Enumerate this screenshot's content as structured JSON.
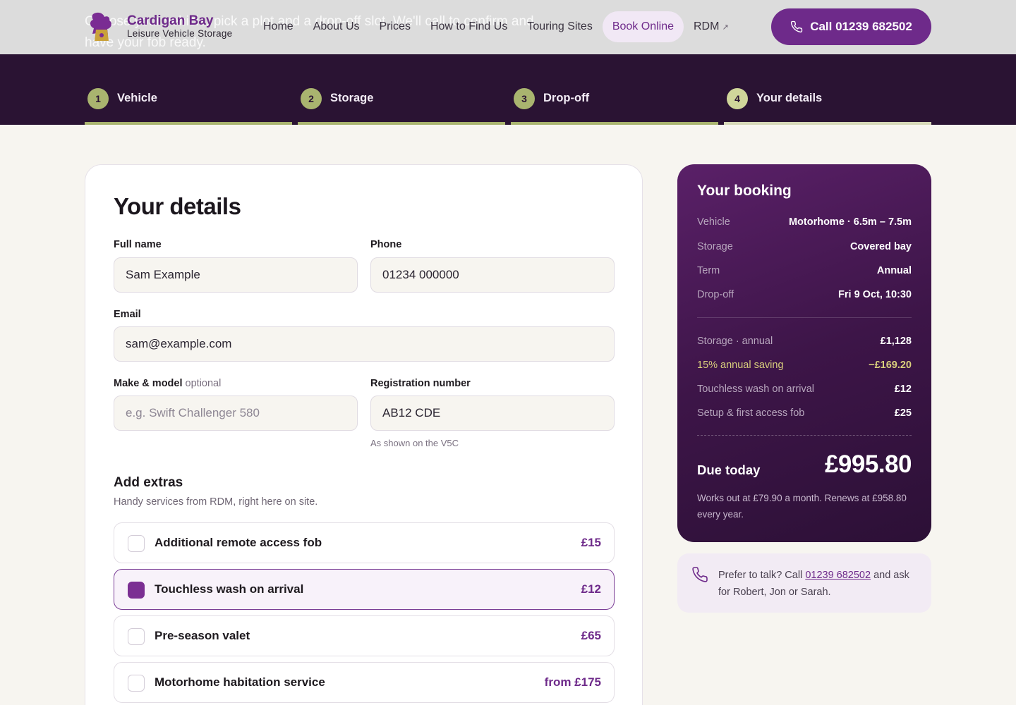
{
  "header": {
    "background_text": "Choose your vehicle, pick a plot and a drop-off slot. We'll call to confirm and have your fob ready.",
    "logo_title": "Cardigan Bay",
    "logo_subtitle": "Leisure Vehicle Storage",
    "nav": [
      {
        "label": "Home"
      },
      {
        "label": "About Us"
      },
      {
        "label": "Prices"
      },
      {
        "label": "How to Find Us"
      },
      {
        "label": "Touring Sites"
      },
      {
        "label": "Book Online",
        "active": true
      },
      {
        "label": "RDM",
        "external": true
      }
    ],
    "call_label": "Call 01239 682502",
    "brand_color": "#6e2a8a"
  },
  "steps": [
    {
      "number": "1",
      "label": "Vehicle"
    },
    {
      "number": "2",
      "label": "Storage"
    },
    {
      "number": "3",
      "label": "Drop-off"
    },
    {
      "number": "4",
      "label": "Your details",
      "current": true
    }
  ],
  "form": {
    "title": "Your details",
    "full_name": {
      "label": "Full name",
      "value": "Sam Example"
    },
    "phone": {
      "label": "Phone",
      "value": "01234 000000"
    },
    "email": {
      "label": "Email",
      "value": "sam@example.com"
    },
    "make_model": {
      "label": "Make & model",
      "optional": "optional",
      "value": "",
      "placeholder": "e.g. Swift Challenger 580"
    },
    "registration": {
      "label": "Registration number",
      "value": "AB12 CDE",
      "hint": "As shown on the V5C"
    },
    "extras_title": "Add extras",
    "extras_subtitle": "Handy services from RDM, right here on site.",
    "extras": [
      {
        "name": "Additional remote access fob",
        "price": "£15",
        "checked": false
      },
      {
        "name": "Touchless wash on arrival",
        "price": "£12",
        "checked": true
      },
      {
        "name": "Pre-season valet",
        "price": "£65",
        "checked": false
      },
      {
        "name": "Motorhome habitation service",
        "price": "from £175",
        "checked": false
      }
    ]
  },
  "summary": {
    "title": "Your booking",
    "details": [
      {
        "key": "Vehicle",
        "value": "Motorhome · 6.5m – 7.5m"
      },
      {
        "key": "Storage",
        "value": "Covered bay"
      },
      {
        "key": "Term",
        "value": "Annual"
      },
      {
        "key": "Drop-off",
        "value": "Fri 9 Oct, 10:30"
      }
    ],
    "lines": [
      {
        "key": "Storage · annual",
        "value": "£1,128"
      },
      {
        "key": "15% annual saving",
        "value": "−£169.20"
      },
      {
        "key": "Touchless wash on arrival",
        "value": "£12"
      },
      {
        "key": "Setup & first access fob",
        "value": "£25"
      }
    ],
    "due_label": "Due today",
    "due_value": "£995.80",
    "note": "Works out at £79.90 a month. Renews at £958.80 every year."
  },
  "talk": {
    "prefix": "Prefer to talk? Call ",
    "phone": "01239 682502",
    "suffix": " and ask for Robert, Jon or Sarah."
  }
}
